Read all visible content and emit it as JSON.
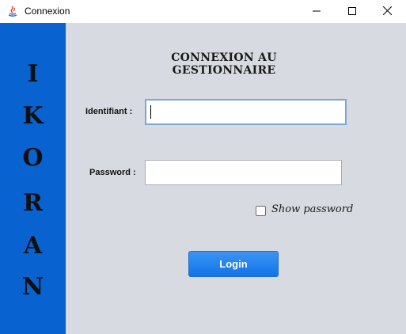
{
  "window": {
    "title": "Connexion",
    "controls": {
      "minimize": "minimize-icon",
      "maximize": "maximize-icon",
      "close": "close-icon"
    }
  },
  "sidebar": {
    "brand_letters": [
      "I",
      "K",
      "O",
      "R",
      "A",
      "N"
    ],
    "color": "#0863d0"
  },
  "form": {
    "heading": "CONNEXION AU GESTIONNAIRE",
    "username_label": "Identifiant :",
    "username_value": "",
    "password_label": "Password :",
    "password_value": "",
    "show_password_label": "Show password",
    "show_password_checked": false,
    "login_label": "Login",
    "login_color": "#1a7fe8"
  }
}
